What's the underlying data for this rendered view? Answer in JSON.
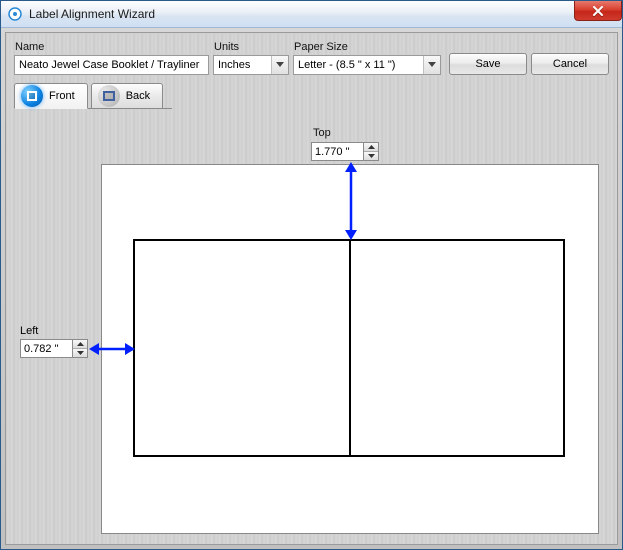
{
  "window": {
    "title": "Label Alignment Wizard"
  },
  "fields": {
    "name_label": "Name",
    "name_value": "Neato Jewel Case Booklet / Trayliner",
    "units_label": "Units",
    "units_value": "Inches",
    "paper_label": "Paper Size",
    "paper_value": "Letter - (8.5 \" x 11 \")"
  },
  "buttons": {
    "save": "Save",
    "cancel": "Cancel"
  },
  "tabs": {
    "front": "Front",
    "back": "Back",
    "active": "front"
  },
  "offsets": {
    "top_label": "Top",
    "top_value": "1.770 \"",
    "left_label": "Left",
    "left_value": "0.782 \""
  },
  "colors": {
    "arrow": "#0020ff"
  }
}
